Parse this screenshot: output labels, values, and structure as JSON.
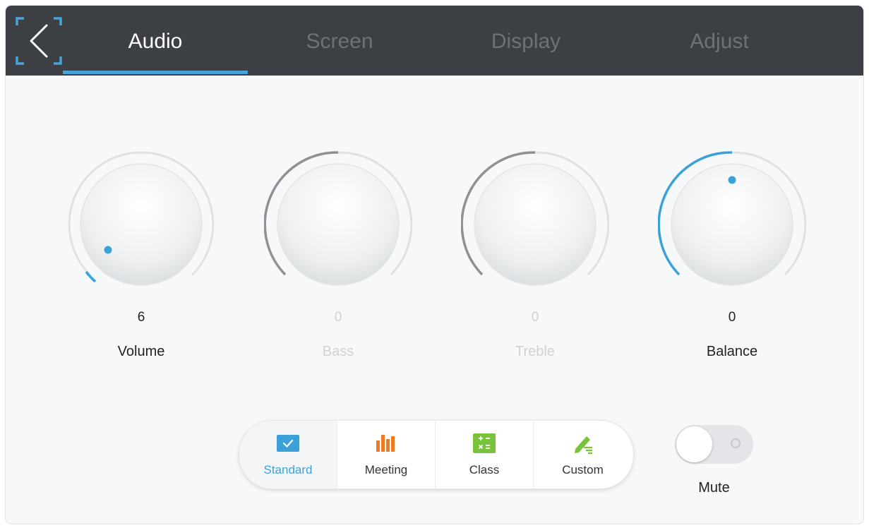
{
  "header": {
    "back_icon": "chevron-left-icon",
    "tabs": [
      {
        "label": "Audio",
        "active": true
      },
      {
        "label": "Screen",
        "active": false
      },
      {
        "label": "Display",
        "active": false
      },
      {
        "label": "Adjust",
        "active": false
      }
    ],
    "accent_color": "#4aa3d8"
  },
  "knobs": [
    {
      "label": "Volume",
      "value": "6",
      "enabled": true,
      "level_fraction": 0.06
    },
    {
      "label": "Bass",
      "value": "0",
      "enabled": false,
      "level_fraction": 0.5
    },
    {
      "label": "Treble",
      "value": "0",
      "enabled": false,
      "level_fraction": 0.5
    },
    {
      "label": "Balance",
      "value": "0",
      "enabled": true,
      "level_fraction": 0.5
    }
  ],
  "modes": [
    {
      "label": "Standard",
      "icon": "standard-icon",
      "active": true,
      "color": "#3ba2d9"
    },
    {
      "label": "Meeting",
      "icon": "meeting-icon",
      "active": false,
      "color": "#ee7a22"
    },
    {
      "label": "Class",
      "icon": "class-icon",
      "active": false,
      "color": "#79c23b"
    },
    {
      "label": "Custom",
      "icon": "custom-icon",
      "active": false,
      "color": "#79c23b"
    }
  ],
  "mute": {
    "label": "Mute",
    "on": false
  }
}
